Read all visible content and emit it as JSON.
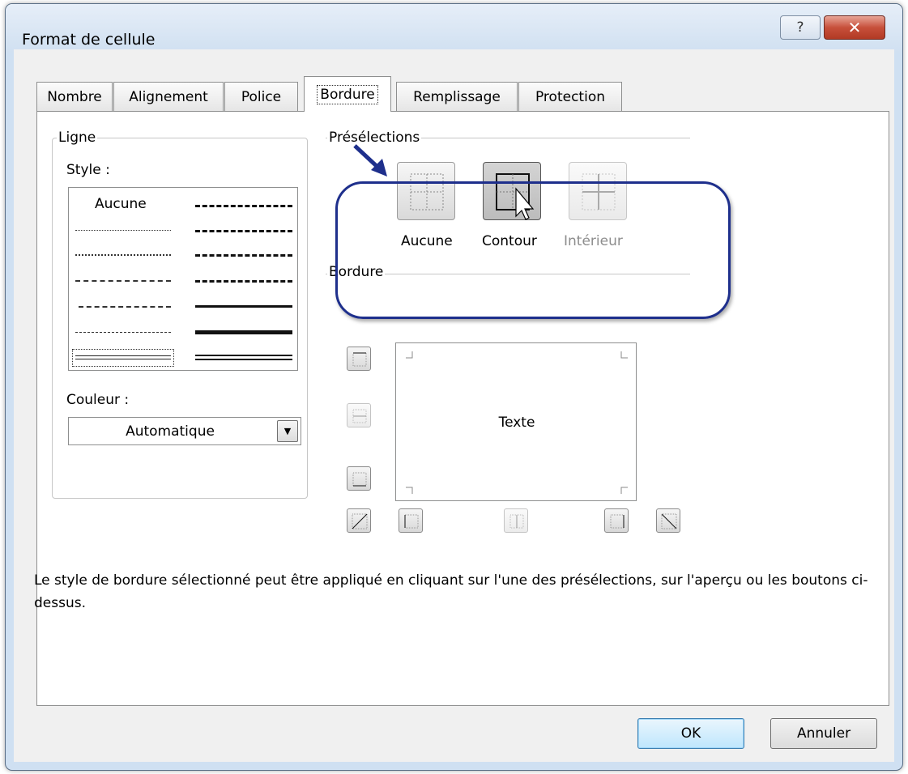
{
  "window": {
    "title": "Format de cellule",
    "help_icon": "?",
    "close_icon": "✕"
  },
  "tabs": [
    {
      "label": "Nombre",
      "active": false
    },
    {
      "label": "Alignement",
      "active": false
    },
    {
      "label": "Police",
      "active": false
    },
    {
      "label": "Bordure",
      "active": true
    },
    {
      "label": "Remplissage",
      "active": false
    },
    {
      "label": "Protection",
      "active": false
    }
  ],
  "line_group": {
    "legend": "Ligne",
    "style_label": "Style :",
    "style_none": "Aucune",
    "color_label": "Couleur :",
    "color_value": "Automatique"
  },
  "presets": {
    "legend": "Présélections",
    "none": "Aucune",
    "outline": "Contour",
    "inside": "Intérieur"
  },
  "border": {
    "legend": "Bordure",
    "preview_text": "Texte"
  },
  "help_text": "Le style de bordure sélectionné peut être appliqué en cliquant sur l'une des présélections, sur l'aperçu ou les boutons ci-dessus.",
  "buttons": {
    "ok": "OK",
    "cancel": "Annuler"
  },
  "colors": {
    "highlight": "#1e2f8c",
    "title_bar": "#cfe0f2",
    "close": "#c7503b"
  }
}
